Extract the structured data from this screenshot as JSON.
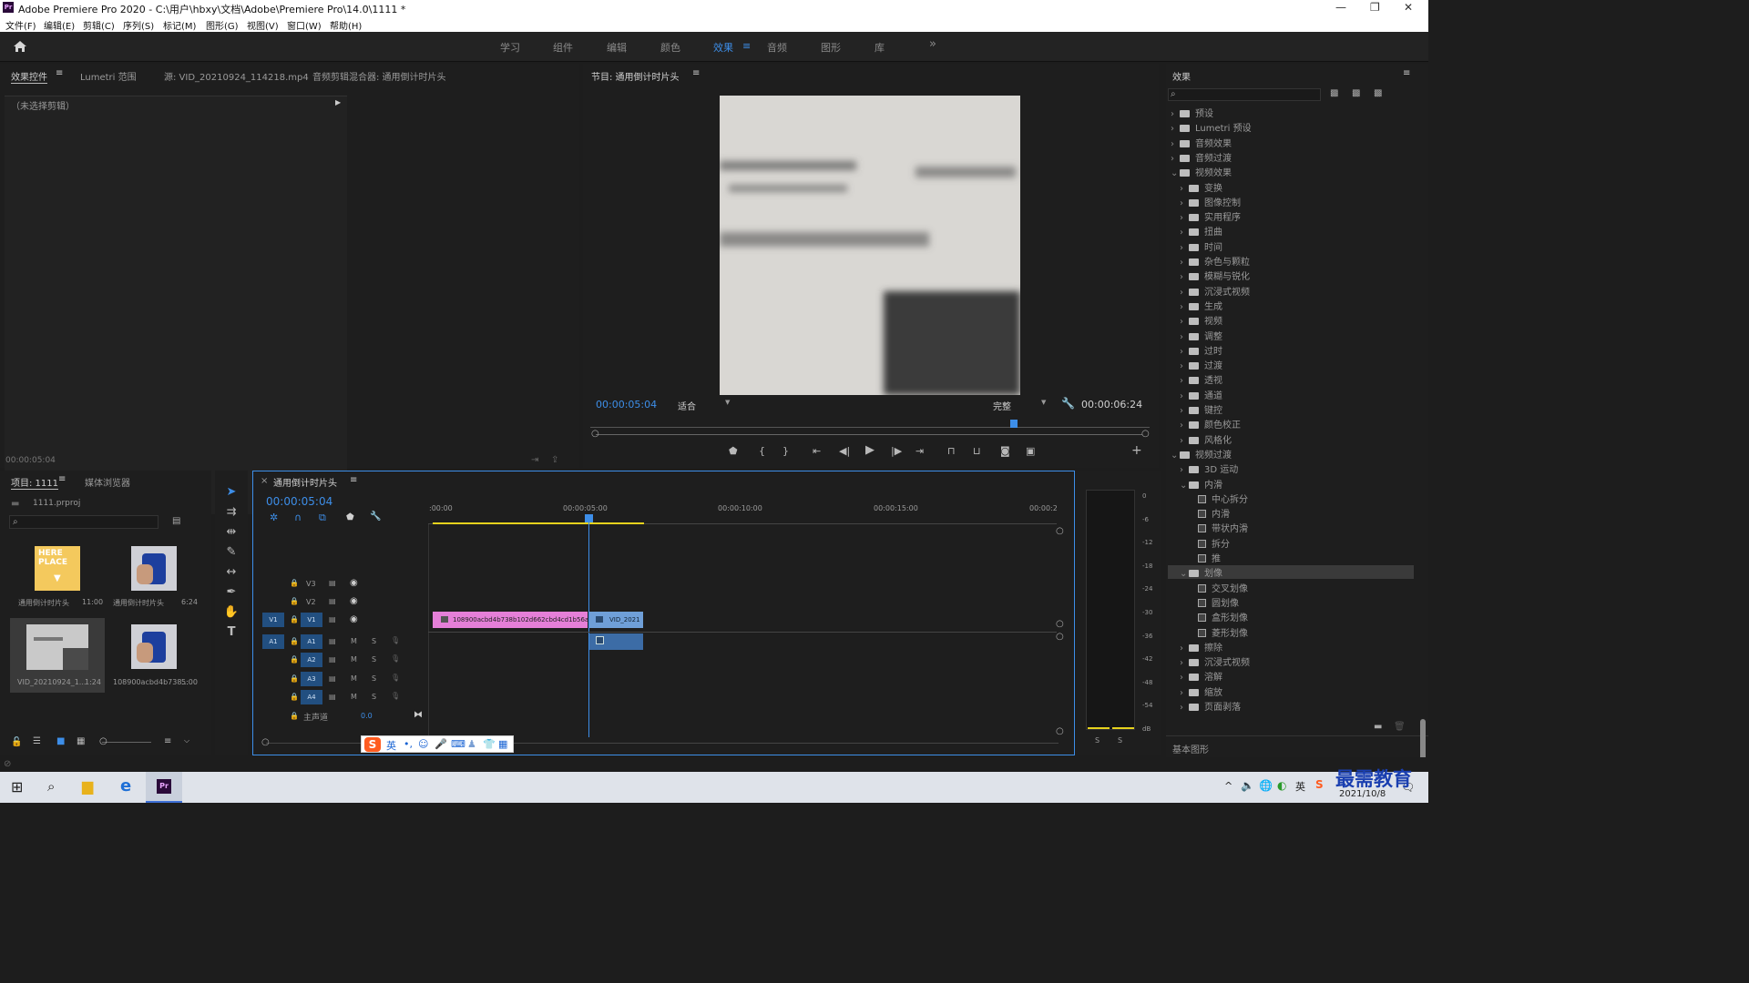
{
  "app": {
    "title": "Adobe Premiere Pro 2020 - C:\\用户\\hbxy\\文档\\Adobe\\Premiere Pro\\14.0\\1111 *",
    "logo": "Pr"
  },
  "window_controls": [
    "—",
    "❐",
    "✕"
  ],
  "menu": [
    "文件(F)",
    "编辑(E)",
    "剪辑(C)",
    "序列(S)",
    "标记(M)",
    "图形(G)",
    "视图(V)",
    "窗口(W)",
    "帮助(H)"
  ],
  "workspaces": [
    "学习",
    "组件",
    "编辑",
    "颜色",
    "效果",
    "音频",
    "图形",
    "库"
  ],
  "active_workspace": "效果",
  "source_panel": {
    "tabs": [
      "效果控件",
      "Lumetri 范围",
      "源: VID_20210924_114218.mp4",
      "音频剪辑混合器: 通用倒计时片头"
    ],
    "no_clip": "（未选择剪辑）",
    "timecode": "00:00:05:04"
  },
  "program": {
    "title": "节目: 通用倒计时片头",
    "timecode": "00:00:05:04",
    "fit": "适合",
    "quality": "完整",
    "duration": "00:00:06:24",
    "playhead_fraction": 0.75
  },
  "project": {
    "tabs": [
      "项目: 1111",
      "媒体浏览器"
    ],
    "file": "1111.prproj",
    "items": [
      {
        "name": "通用倒计时片头",
        "dur": "11:00"
      },
      {
        "name": "通用倒计时片头",
        "dur": "6:24"
      },
      {
        "name": "VID_20210924_1...",
        "dur": "1:24"
      },
      {
        "name": "108900acbd4b738...",
        "dur": "5:00"
      }
    ]
  },
  "timeline": {
    "tab": "通用倒计时片头",
    "timecode": "00:00:05:04",
    "ruler": [
      ":00:00",
      "00:00:05:00",
      "00:00:10:00",
      "00:00:15:00",
      "00:00:2"
    ],
    "video_tracks": [
      "V3",
      "V2",
      "V1"
    ],
    "audio_tracks": [
      "A1",
      "A2",
      "A3",
      "A4"
    ],
    "src_v": "V1",
    "src_a": "A1",
    "master": "主声道",
    "master_val": "0.0",
    "clip1": "108900acbd4b738b102d662cbd4cd1b56ada",
    "clip2": "VID_2021"
  },
  "meter": {
    "labels": [
      "0",
      "-6",
      "-12",
      "-18",
      "-24",
      "-30",
      "-36",
      "-42",
      "-48",
      "-54",
      "dB"
    ],
    "s": [
      "S",
      "S"
    ]
  },
  "effects": {
    "title": "效果",
    "items": [
      {
        "label": "预设",
        "indent": 0,
        "type": "folder",
        "open": false
      },
      {
        "label": "Lumetri 预设",
        "indent": 0,
        "type": "folder",
        "open": false
      },
      {
        "label": "音频效果",
        "indent": 0,
        "type": "folder",
        "open": false
      },
      {
        "label": "音频过渡",
        "indent": 0,
        "type": "folder",
        "open": false
      },
      {
        "label": "视频效果",
        "indent": 0,
        "type": "folder",
        "open": true
      },
      {
        "label": "变换",
        "indent": 1,
        "type": "folder",
        "open": false
      },
      {
        "label": "图像控制",
        "indent": 1,
        "type": "folder",
        "open": false
      },
      {
        "label": "实用程序",
        "indent": 1,
        "type": "folder",
        "open": false
      },
      {
        "label": "扭曲",
        "indent": 1,
        "type": "folder",
        "open": false
      },
      {
        "label": "时间",
        "indent": 1,
        "type": "folder",
        "open": false
      },
      {
        "label": "杂色与颗粒",
        "indent": 1,
        "type": "folder",
        "open": false
      },
      {
        "label": "模糊与锐化",
        "indent": 1,
        "type": "folder",
        "open": false
      },
      {
        "label": "沉浸式视频",
        "indent": 1,
        "type": "folder",
        "open": false
      },
      {
        "label": "生成",
        "indent": 1,
        "type": "folder",
        "open": false
      },
      {
        "label": "视频",
        "indent": 1,
        "type": "folder",
        "open": false
      },
      {
        "label": "调整",
        "indent": 1,
        "type": "folder",
        "open": false
      },
      {
        "label": "过时",
        "indent": 1,
        "type": "folder",
        "open": false
      },
      {
        "label": "过渡",
        "indent": 1,
        "type": "folder",
        "open": false
      },
      {
        "label": "透视",
        "indent": 1,
        "type": "folder",
        "open": false
      },
      {
        "label": "通道",
        "indent": 1,
        "type": "folder",
        "open": false
      },
      {
        "label": "键控",
        "indent": 1,
        "type": "folder",
        "open": false
      },
      {
        "label": "颜色校正",
        "indent": 1,
        "type": "folder",
        "open": false
      },
      {
        "label": "风格化",
        "indent": 1,
        "type": "folder",
        "open": false
      },
      {
        "label": "视频过渡",
        "indent": 0,
        "type": "folder",
        "open": true
      },
      {
        "label": "3D 运动",
        "indent": 1,
        "type": "folder",
        "open": false
      },
      {
        "label": "内滑",
        "indent": 1,
        "type": "folder",
        "open": true
      },
      {
        "label": "中心拆分",
        "indent": 2,
        "type": "fx"
      },
      {
        "label": "内滑",
        "indent": 2,
        "type": "fx"
      },
      {
        "label": "带状内滑",
        "indent": 2,
        "type": "fx"
      },
      {
        "label": "拆分",
        "indent": 2,
        "type": "fx"
      },
      {
        "label": "推",
        "indent": 2,
        "type": "fx"
      },
      {
        "label": "划像",
        "indent": 1,
        "type": "folder",
        "open": true,
        "selected": true
      },
      {
        "label": "交叉划像",
        "indent": 2,
        "type": "fx"
      },
      {
        "label": "圆划像",
        "indent": 2,
        "type": "fx"
      },
      {
        "label": "盒形划像",
        "indent": 2,
        "type": "fx"
      },
      {
        "label": "菱形划像",
        "indent": 2,
        "type": "fx"
      },
      {
        "label": "擦除",
        "indent": 1,
        "type": "folder",
        "open": false
      },
      {
        "label": "沉浸式视频",
        "indent": 1,
        "type": "folder",
        "open": false
      },
      {
        "label": "溶解",
        "indent": 1,
        "type": "folder",
        "open": false
      },
      {
        "label": "缩放",
        "indent": 1,
        "type": "folder",
        "open": false
      },
      {
        "label": "页面剥落",
        "indent": 1,
        "type": "folder",
        "open": false
      }
    ],
    "footer": "基本图形"
  },
  "ime": {
    "lang": "英"
  },
  "taskbar": {
    "date": "2021/10/8",
    "watermark": "最需教育"
  },
  "colors": {
    "accent": "#3d8ee8",
    "clip_pink": "#e57fd8",
    "clip_blue": "#6f9fd8",
    "track_blue": "#224f80",
    "yellow": "#e6d21d"
  }
}
